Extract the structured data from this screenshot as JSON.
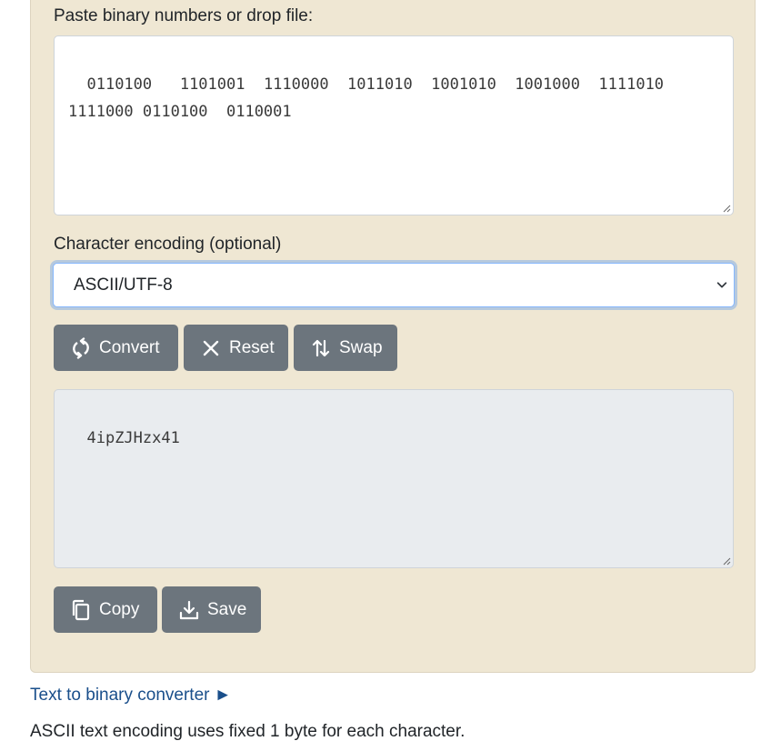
{
  "input": {
    "label": "Paste binary numbers or drop file:",
    "value": "0110100   1101001  1110000  1011010  1001010  1001000  1111010\n1111000 0110100  0110001"
  },
  "encoding": {
    "label": "Character encoding (optional)",
    "selected": "ASCII/UTF-8"
  },
  "actions": {
    "convert": "Convert",
    "reset": "Reset",
    "swap": "Swap"
  },
  "output": {
    "value": "4ipZJHzx41"
  },
  "output_actions": {
    "copy": "Copy",
    "save": "Save"
  },
  "link": {
    "text": "Text to binary converter",
    "arrow": "►"
  },
  "note": "ASCII text encoding uses fixed 1 byte for each character.",
  "colors": {
    "panel_bg": "#efe7d3",
    "button_bg": "#6c757d",
    "link": "#1a4f8b",
    "readonly_bg": "#e9ecef",
    "focus_border": "#86b7fe"
  },
  "icons": {
    "convert": "refresh-icon",
    "reset": "close-icon",
    "swap": "swap-icon",
    "copy": "copy-icon",
    "save": "download-icon",
    "select": "chevron-down-icon"
  }
}
